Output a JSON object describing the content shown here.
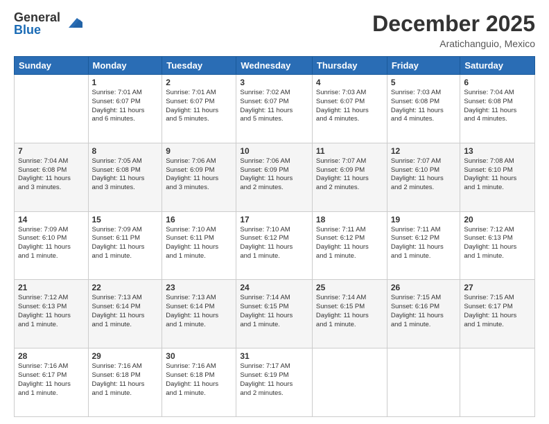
{
  "logo": {
    "general": "General",
    "blue": "Blue"
  },
  "header": {
    "month": "December 2025",
    "location": "Aratichanguio, Mexico"
  },
  "days_of_week": [
    "Sunday",
    "Monday",
    "Tuesday",
    "Wednesday",
    "Thursday",
    "Friday",
    "Saturday"
  ],
  "weeks": [
    [
      {
        "num": "",
        "info": ""
      },
      {
        "num": "1",
        "info": "Sunrise: 7:01 AM\nSunset: 6:07 PM\nDaylight: 11 hours\nand 6 minutes."
      },
      {
        "num": "2",
        "info": "Sunrise: 7:01 AM\nSunset: 6:07 PM\nDaylight: 11 hours\nand 5 minutes."
      },
      {
        "num": "3",
        "info": "Sunrise: 7:02 AM\nSunset: 6:07 PM\nDaylight: 11 hours\nand 5 minutes."
      },
      {
        "num": "4",
        "info": "Sunrise: 7:03 AM\nSunset: 6:07 PM\nDaylight: 11 hours\nand 4 minutes."
      },
      {
        "num": "5",
        "info": "Sunrise: 7:03 AM\nSunset: 6:08 PM\nDaylight: 11 hours\nand 4 minutes."
      },
      {
        "num": "6",
        "info": "Sunrise: 7:04 AM\nSunset: 6:08 PM\nDaylight: 11 hours\nand 4 minutes."
      }
    ],
    [
      {
        "num": "7",
        "info": "Sunrise: 7:04 AM\nSunset: 6:08 PM\nDaylight: 11 hours\nand 3 minutes."
      },
      {
        "num": "8",
        "info": "Sunrise: 7:05 AM\nSunset: 6:08 PM\nDaylight: 11 hours\nand 3 minutes."
      },
      {
        "num": "9",
        "info": "Sunrise: 7:06 AM\nSunset: 6:09 PM\nDaylight: 11 hours\nand 3 minutes."
      },
      {
        "num": "10",
        "info": "Sunrise: 7:06 AM\nSunset: 6:09 PM\nDaylight: 11 hours\nand 2 minutes."
      },
      {
        "num": "11",
        "info": "Sunrise: 7:07 AM\nSunset: 6:09 PM\nDaylight: 11 hours\nand 2 minutes."
      },
      {
        "num": "12",
        "info": "Sunrise: 7:07 AM\nSunset: 6:10 PM\nDaylight: 11 hours\nand 2 minutes."
      },
      {
        "num": "13",
        "info": "Sunrise: 7:08 AM\nSunset: 6:10 PM\nDaylight: 11 hours\nand 1 minute."
      }
    ],
    [
      {
        "num": "14",
        "info": "Sunrise: 7:09 AM\nSunset: 6:10 PM\nDaylight: 11 hours\nand 1 minute."
      },
      {
        "num": "15",
        "info": "Sunrise: 7:09 AM\nSunset: 6:11 PM\nDaylight: 11 hours\nand 1 minute."
      },
      {
        "num": "16",
        "info": "Sunrise: 7:10 AM\nSunset: 6:11 PM\nDaylight: 11 hours\nand 1 minute."
      },
      {
        "num": "17",
        "info": "Sunrise: 7:10 AM\nSunset: 6:12 PM\nDaylight: 11 hours\nand 1 minute."
      },
      {
        "num": "18",
        "info": "Sunrise: 7:11 AM\nSunset: 6:12 PM\nDaylight: 11 hours\nand 1 minute."
      },
      {
        "num": "19",
        "info": "Sunrise: 7:11 AM\nSunset: 6:12 PM\nDaylight: 11 hours\nand 1 minute."
      },
      {
        "num": "20",
        "info": "Sunrise: 7:12 AM\nSunset: 6:13 PM\nDaylight: 11 hours\nand 1 minute."
      }
    ],
    [
      {
        "num": "21",
        "info": "Sunrise: 7:12 AM\nSunset: 6:13 PM\nDaylight: 11 hours\nand 1 minute."
      },
      {
        "num": "22",
        "info": "Sunrise: 7:13 AM\nSunset: 6:14 PM\nDaylight: 11 hours\nand 1 minute."
      },
      {
        "num": "23",
        "info": "Sunrise: 7:13 AM\nSunset: 6:14 PM\nDaylight: 11 hours\nand 1 minute."
      },
      {
        "num": "24",
        "info": "Sunrise: 7:14 AM\nSunset: 6:15 PM\nDaylight: 11 hours\nand 1 minute."
      },
      {
        "num": "25",
        "info": "Sunrise: 7:14 AM\nSunset: 6:15 PM\nDaylight: 11 hours\nand 1 minute."
      },
      {
        "num": "26",
        "info": "Sunrise: 7:15 AM\nSunset: 6:16 PM\nDaylight: 11 hours\nand 1 minute."
      },
      {
        "num": "27",
        "info": "Sunrise: 7:15 AM\nSunset: 6:17 PM\nDaylight: 11 hours\nand 1 minute."
      }
    ],
    [
      {
        "num": "28",
        "info": "Sunrise: 7:16 AM\nSunset: 6:17 PM\nDaylight: 11 hours\nand 1 minute."
      },
      {
        "num": "29",
        "info": "Sunrise: 7:16 AM\nSunset: 6:18 PM\nDaylight: 11 hours\nand 1 minute."
      },
      {
        "num": "30",
        "info": "Sunrise: 7:16 AM\nSunset: 6:18 PM\nDaylight: 11 hours\nand 1 minute."
      },
      {
        "num": "31",
        "info": "Sunrise: 7:17 AM\nSunset: 6:19 PM\nDaylight: 11 hours\nand 2 minutes."
      },
      {
        "num": "",
        "info": ""
      },
      {
        "num": "",
        "info": ""
      },
      {
        "num": "",
        "info": ""
      }
    ]
  ]
}
